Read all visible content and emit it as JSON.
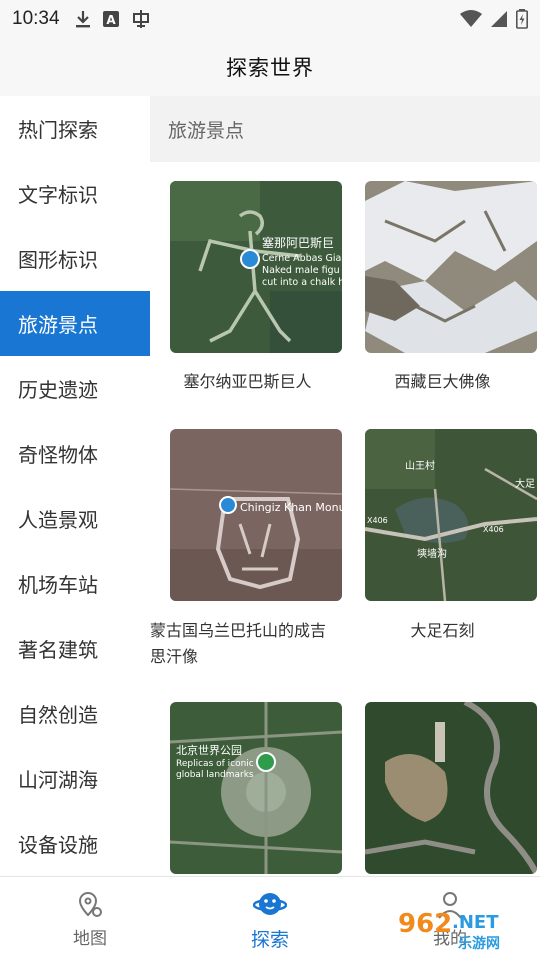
{
  "status_bar": {
    "time": "10:34",
    "icons": [
      "download-icon",
      "a-icon",
      "notification-icon",
      "wifi-icon",
      "signal-icon",
      "battery-icon"
    ]
  },
  "header": {
    "title": "探索世界"
  },
  "sidebar": {
    "items": [
      {
        "label": "热门探索",
        "active": false
      },
      {
        "label": "文字标识",
        "active": false
      },
      {
        "label": "图形标识",
        "active": false
      },
      {
        "label": "旅游景点",
        "active": true
      },
      {
        "label": "历史遗迹",
        "active": false
      },
      {
        "label": "奇怪物体",
        "active": false
      },
      {
        "label": "人造景观",
        "active": false
      },
      {
        "label": "机场车站",
        "active": false
      },
      {
        "label": "著名建筑",
        "active": false
      },
      {
        "label": "自然创造",
        "active": false
      },
      {
        "label": "山河湖海",
        "active": false
      },
      {
        "label": "设备设施",
        "active": false
      }
    ]
  },
  "content": {
    "section_title": "旅游景点",
    "cards": [
      {
        "caption": "塞尔纳亚巴斯巨人",
        "map_label_1": "塞那阿巴斯巨",
        "map_label_2": "Cerne Abbas Gia",
        "map_label_3": "Naked male figu",
        "map_label_4": "cut into a chalk h"
      },
      {
        "caption": "西藏巨大佛像"
      },
      {
        "caption": "蒙古国乌兰巴托山的成吉思汗像",
        "caption_line1": "蒙古国乌兰巴托山的成吉",
        "caption_line2": "思汗像",
        "map_label_1": "Chingiz Khan Monu"
      },
      {
        "caption": "大足石刻",
        "map_label_1": "山王村",
        "map_label_2": "X406",
        "map_label_3": "X406",
        "map_label_4": "大足",
        "map_label_5": "塽墙沟"
      },
      {
        "caption": "",
        "map_label_1": "北京世界公园",
        "map_label_2": "Replicas of iconic",
        "map_label_3": "global landmarks"
      },
      {
        "caption": ""
      }
    ]
  },
  "bottom_nav": {
    "items": [
      {
        "label": "地图",
        "icon": "map-pin-icon",
        "active": false
      },
      {
        "label": "探索",
        "icon": "planet-icon",
        "active": true
      },
      {
        "label": "我的",
        "icon": "person-icon",
        "active": false
      }
    ]
  },
  "watermark": {
    "text1": "962",
    "text2": ".NET",
    "text3": "乐游网"
  },
  "colors": {
    "accent": "#1976d2",
    "sidebar_bg": "#ffffff",
    "header_bg": "#f7f7f7"
  }
}
